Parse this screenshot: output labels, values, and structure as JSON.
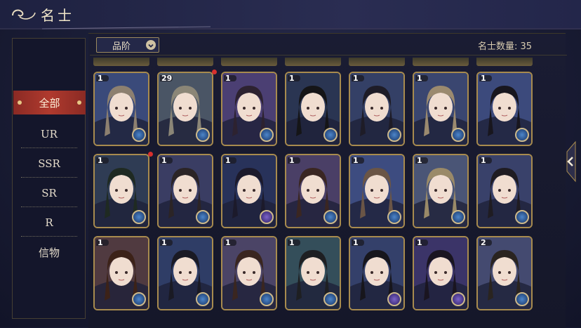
{
  "header": {
    "title": "名士"
  },
  "sidebar": {
    "items": [
      {
        "label": "全部",
        "active": true
      },
      {
        "label": "UR"
      },
      {
        "label": "SSR"
      },
      {
        "label": "SR"
      },
      {
        "label": "R"
      },
      {
        "label": "信物"
      }
    ]
  },
  "toolbar": {
    "filter_label": "品阶",
    "count_text": "名士数量: 35"
  },
  "grid": {
    "rows": [
      [
        {
          "level": "1",
          "badge": "blue",
          "hair": "#8d8070",
          "bg": "#3a4a7a"
        },
        {
          "level": "29",
          "badge": "blue",
          "hair": "#8b8677",
          "bg": "#4a5565",
          "red_dot": true
        },
        {
          "level": "1",
          "badge": "blue",
          "hair": "#2d2230",
          "bg": "#4b3f73"
        },
        {
          "level": "1",
          "badge": "blue",
          "hair": "#151517",
          "bg": "#2a3552"
        },
        {
          "level": "1",
          "badge": "blue",
          "hair": "#1e1c27",
          "bg": "#344066"
        },
        {
          "level": "1",
          "badge": "blue",
          "hair": "#9b8a6f",
          "bg": "#3a4670"
        },
        {
          "level": "1",
          "badge": "blue",
          "hair": "#18161e",
          "bg": "#3c4a7c"
        }
      ],
      [
        {
          "level": "1",
          "badge": "blue",
          "hair": "#1f2a22",
          "bg": "#2f3c54",
          "red_dot": true
        },
        {
          "level": "1",
          "badge": "blue",
          "hair": "#2b2426",
          "bg": "#3a3d63"
        },
        {
          "level": "1",
          "badge": "purple",
          "hair": "#1c1a2b",
          "bg": "#28325a"
        },
        {
          "level": "1",
          "badge": "blue",
          "hair": "#3a2622",
          "bg": "#4a3f66"
        },
        {
          "level": "1",
          "badge": "blue",
          "hair": "#6a5546",
          "bg": "#3d4c80"
        },
        {
          "level": "1",
          "badge": "blue",
          "hair": "#9a8a68",
          "bg": "#4a5576"
        },
        {
          "level": "1",
          "badge": "blue",
          "hair": "#1f1c22",
          "bg": "#39416a"
        }
      ],
      [
        {
          "level": "1",
          "badge": "blue",
          "hair": "#3c2218",
          "bg": "#503a40"
        },
        {
          "level": "1",
          "badge": "blue",
          "hair": "#1a1a24",
          "bg": "#2f3d66"
        },
        {
          "level": "1",
          "badge": "blue",
          "hair": "#3a2620",
          "bg": "#4b4466"
        },
        {
          "level": "1",
          "badge": "blue",
          "hair": "#1e1f22",
          "bg": "#344e5a"
        },
        {
          "level": "1",
          "badge": "purple",
          "hair": "#17161c",
          "bg": "#34406a"
        },
        {
          "level": "1",
          "badge": "purple",
          "hair": "#1a1520",
          "bg": "#3b3468"
        },
        {
          "level": "2",
          "badge": "blue",
          "hair": "#2a2420",
          "bg": "#444a70"
        }
      ]
    ]
  },
  "colors": {
    "accent_red": "#b03a2e",
    "gold_border": "#a88b4e",
    "text_light": "#e5dccb"
  }
}
